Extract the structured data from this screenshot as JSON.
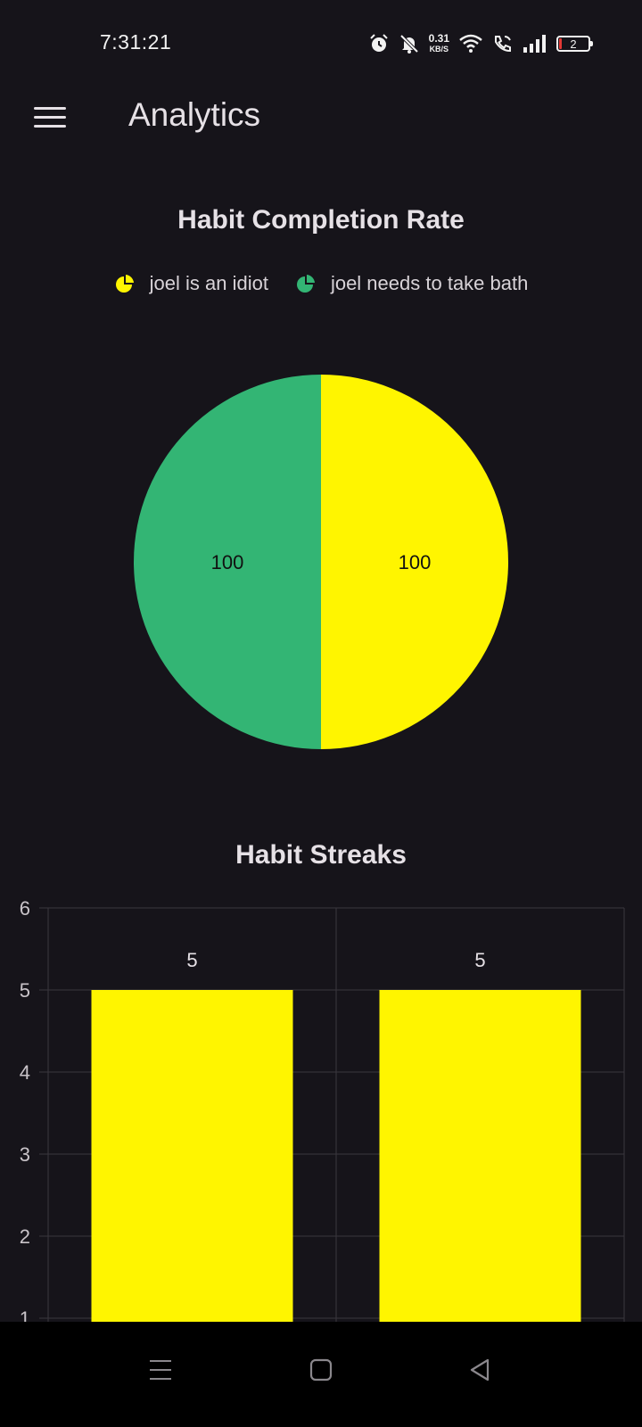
{
  "status_bar": {
    "time": "7:31:21",
    "net_speed_value": "0.31",
    "net_speed_unit": "KB/S",
    "battery_level": "2",
    "icons": [
      "alarm-icon",
      "silent-icon",
      "wifi-icon",
      "wifi-calling-icon",
      "signal-icon",
      "battery-icon"
    ]
  },
  "app_bar": {
    "title": "Analytics",
    "menu_icon": "menu-icon"
  },
  "colors": {
    "background": "#16141a",
    "yellow": "#fff500",
    "green": "#33b574",
    "grid": "#3a373e"
  },
  "chart_data": [
    {
      "type": "pie",
      "title": "Habit Completion Rate",
      "legend": [
        {
          "label": "joel is an idiot",
          "color": "#fff500"
        },
        {
          "label": "joel needs to take bath",
          "color": "#33b574"
        }
      ],
      "slices": [
        {
          "label": "joel is an idiot",
          "value": 100,
          "color": "#fff500"
        },
        {
          "label": "joel needs to take bath",
          "value": 100,
          "color": "#33b574"
        }
      ]
    },
    {
      "type": "bar",
      "title": "Habit Streaks",
      "values": [
        5,
        5
      ],
      "data_labels": [
        "5",
        "5"
      ],
      "ylim": [
        0,
        6
      ],
      "y_ticks": [
        1,
        2,
        3,
        4,
        5,
        6
      ],
      "y_tick_labels": [
        "1",
        "2",
        "3",
        "4",
        "5",
        "6"
      ],
      "grid": true,
      "bar_color": "#fff500"
    }
  ],
  "bottom_nav": {
    "icons": [
      "recent-apps-icon",
      "home-icon",
      "back-icon"
    ]
  }
}
